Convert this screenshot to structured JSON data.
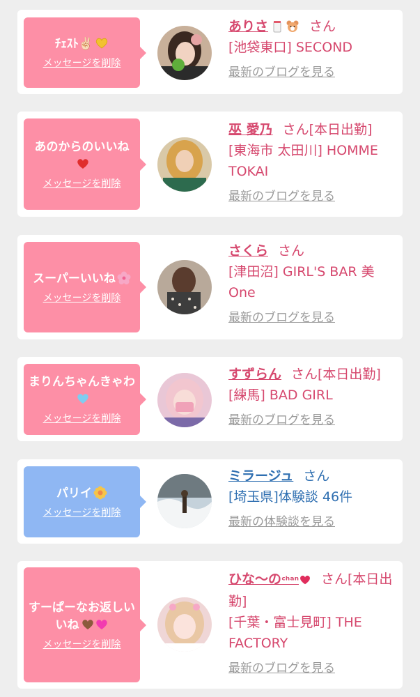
{
  "items": [
    {
      "message": "ﾁｪｽﾄ✌🏻",
      "delete_label": "メッセージを削除",
      "name": "ありさ",
      "suffix": "さん",
      "shop": "[池袋東口] SECOND",
      "blog_label": "最新のブログを見る"
    },
    {
      "message": "あのからのいいね",
      "delete_label": "メッセージを削除",
      "name": "巫 愛乃",
      "suffix": "さん[本日出勤]",
      "shop": "[東海市 太田川] HOMME TOKAI",
      "blog_label": "最新のブログを見る"
    },
    {
      "message": "スーパーいいね",
      "delete_label": "メッセージを削除",
      "name": "さくら",
      "suffix": "さん",
      "shop": "[津田沼] GIRL'S BAR 美One",
      "blog_label": "最新のブログを見る"
    },
    {
      "message": "まりんちゃんきゃわ",
      "delete_label": "メッセージを削除",
      "name": "すずらん",
      "suffix": "さん[本日出勤]",
      "shop": "[練馬] BAD GIRL",
      "blog_label": "最新のブログを見る"
    },
    {
      "message": "パリイ",
      "delete_label": "メッセージを削除",
      "name": "ミラージュ",
      "suffix": "さん",
      "shop": "[埼玉県]体験談 46件",
      "blog_label": "最新の体験談を見る"
    },
    {
      "message": "すーぱーなお返しいいね",
      "delete_label": "メッセージを削除",
      "name": "ひな〜の",
      "name_chan": "ᶜʰᵃⁿ",
      "suffix": "さん[本日出勤]",
      "shop": "[千葉・富士見町] THE FACTORY",
      "blog_label": "最新のブログを見る"
    }
  ],
  "icons": {
    "item0_message": [
      "victory-hand-icon",
      "yellow-heart-icon"
    ],
    "item0_name": [
      "milk-icon",
      "bear-icon"
    ],
    "item1_message": [
      "red-heart-icon"
    ],
    "item2_message": [
      "cherry-blossom-icon"
    ],
    "item3_message": [
      "light-blue-heart-icon"
    ],
    "item4_message": [
      "flower-medal-icon"
    ],
    "item5_name": [
      "heart-icon"
    ],
    "item5_message": [
      "brown-heart-icon",
      "pink-heart-icon"
    ]
  },
  "colors": {
    "pink_bubble": "#fd8fa6",
    "blue_bubble": "#8fb7f3",
    "pink_text": "#d6486e",
    "blue_text": "#2f6fb1",
    "link_gray": "#9a9a9a",
    "background": "#eeeeee"
  }
}
